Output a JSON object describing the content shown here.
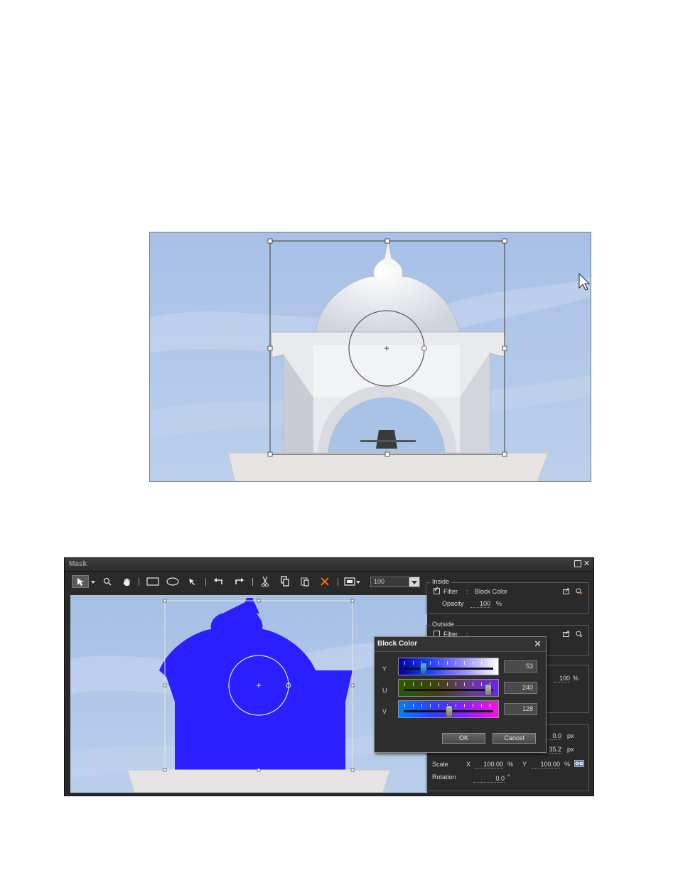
{
  "mask_window": {
    "title": "Mask",
    "zoom_value": "100",
    "toolbar_tools": [
      "select-icon",
      "zoom-icon",
      "hand-icon",
      "rectangle-icon",
      "ellipse-icon",
      "pen-icon",
      "undo-icon",
      "redo-icon",
      "cut-icon",
      "copy-icon",
      "paste-icon",
      "delete-icon",
      "view-mode-icon"
    ],
    "inside": {
      "label": "Inside",
      "filter_label": "Filter",
      "filter_checked": true,
      "filter_value": "Block Color",
      "opacity_label": "Opacity",
      "opacity_value": "100",
      "opacity_unit": "%"
    },
    "outside": {
      "label": "Outside",
      "filter_label": "Filter",
      "filter_checked": false
    },
    "partial_opacity_value": "100",
    "partial_opacity_unit": "%",
    "position": {
      "x_value": "0.0",
      "x_unit": "px",
      "y_value": "35.2",
      "y_unit": "px"
    },
    "scale": {
      "label": "Scale",
      "x_label": "X",
      "x_value": "100.00",
      "x_unit": "%",
      "y_label": "Y",
      "y_value": "100.00",
      "y_unit": "%"
    },
    "rotation": {
      "label": "Rotation",
      "value": "0.0",
      "unit": "°"
    }
  },
  "block_color_dialog": {
    "title": "Block Color",
    "sliders": [
      {
        "label": "Y",
        "value": "53",
        "level": 0.21
      },
      {
        "label": "U",
        "value": "240",
        "level": 0.94
      },
      {
        "label": "V",
        "value": "128",
        "level": 0.5
      }
    ],
    "ok_label": "OK",
    "cancel_label": "Cancel"
  },
  "colors": {
    "mask_fill": "#2a1fff",
    "sky": "#a9c3e6",
    "window_bg": "#2a2a2a"
  }
}
